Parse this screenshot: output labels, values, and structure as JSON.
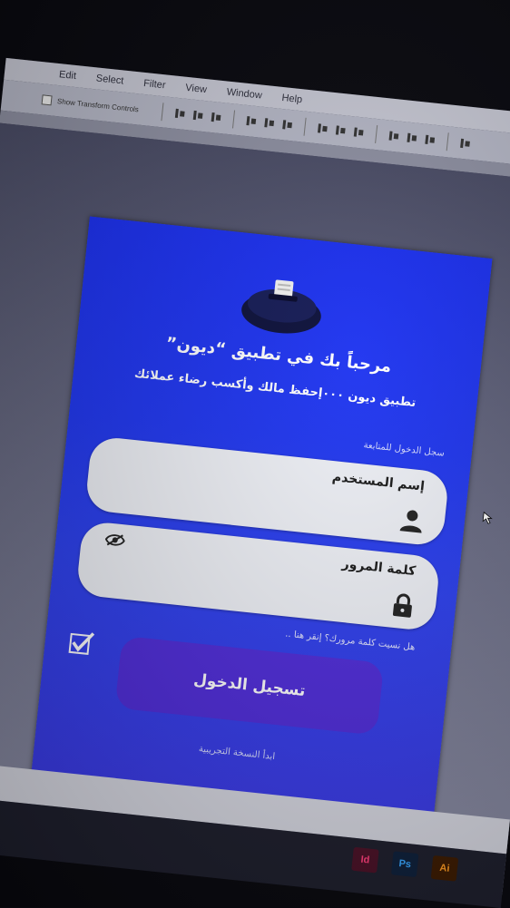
{
  "menubar": {
    "items": [
      "Edit",
      "Select",
      "Filter",
      "View",
      "Window",
      "Help"
    ]
  },
  "toolbar": {
    "show_transform_label": "Show Transform Controls"
  },
  "artboard": {
    "welcome_title": "مرحباً بك في تطبيق “ديون”",
    "welcome_subtitle": "تطبيق ديون ٠٠٠إحفظ مالك وأكسب رضاء عملائك",
    "login_hint": "سجل الدخول للمتابعة",
    "username_label": "إسم المستخدم",
    "username_value": "",
    "password_label": "كلمة المرور",
    "password_value": "",
    "forgot_password": "هل نسيت كلمة مرورك؟ إنقر هنا ..",
    "login_button": "تسجيل الدخول",
    "trial_link": "ابدأ النسخة التجريبية"
  },
  "taskbar": {
    "apps": [
      "Id",
      "Ps",
      "Ai"
    ]
  },
  "colors": {
    "artboard_blue": "#1f36f0",
    "button_purple": "#4f2cd9",
    "field_bg": "#eef0f6"
  },
  "icons": {
    "username": "user-icon",
    "password": "lock-icon",
    "visibility": "eye-off-icon",
    "remember": "checkmark-icon",
    "logo": "thermal-printer-icon"
  }
}
